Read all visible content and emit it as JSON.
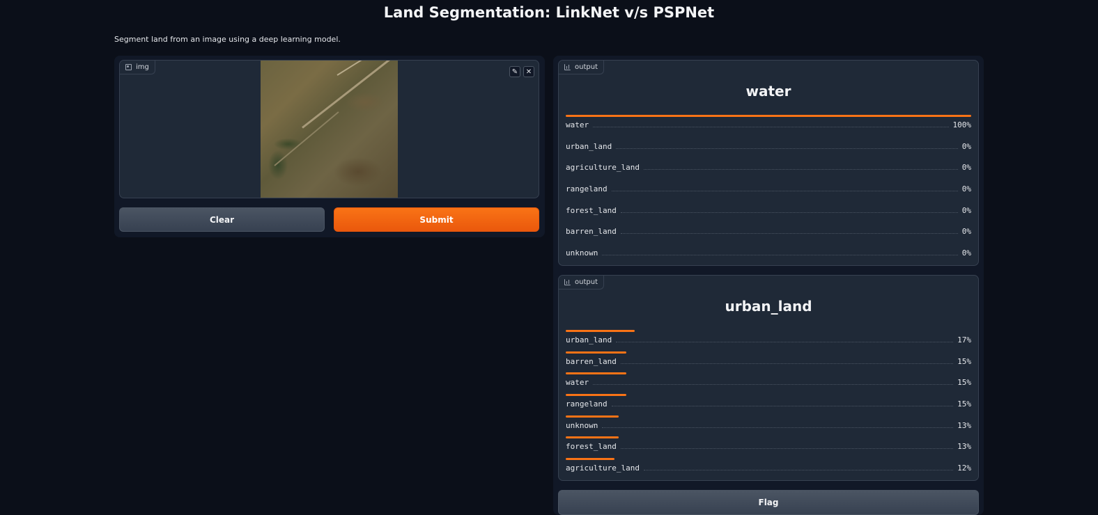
{
  "header": {
    "title": "Land Segmentation: LinkNet v/s PSPNet",
    "description": "Segment land from an image using a deep learning model."
  },
  "input": {
    "tag_label": "img",
    "image_alt": "satellite image",
    "edit_icon": "pencil-icon",
    "close_icon": "close-icon"
  },
  "buttons": {
    "clear": "Clear",
    "submit": "Submit",
    "flag": "Flag"
  },
  "outputs": [
    {
      "tag_label": "output",
      "top_label": "water",
      "rows": [
        {
          "label": "water",
          "value": "100%",
          "fraction": 1.0
        },
        {
          "label": "urban_land",
          "value": "0%",
          "fraction": 0.0
        },
        {
          "label": "agriculture_land",
          "value": "0%",
          "fraction": 0.0
        },
        {
          "label": "rangeland",
          "value": "0%",
          "fraction": 0.0
        },
        {
          "label": "forest_land",
          "value": "0%",
          "fraction": 0.0
        },
        {
          "label": "barren_land",
          "value": "0%",
          "fraction": 0.0
        },
        {
          "label": "unknown",
          "value": "0%",
          "fraction": 0.0
        }
      ]
    },
    {
      "tag_label": "output",
      "top_label": "urban_land",
      "rows": [
        {
          "label": "urban_land",
          "value": "17%",
          "fraction": 0.17
        },
        {
          "label": "barren_land",
          "value": "15%",
          "fraction": 0.15
        },
        {
          "label": "water",
          "value": "15%",
          "fraction": 0.15
        },
        {
          "label": "rangeland",
          "value": "15%",
          "fraction": 0.15
        },
        {
          "label": "unknown",
          "value": "13%",
          "fraction": 0.13
        },
        {
          "label": "forest_land",
          "value": "13%",
          "fraction": 0.13
        },
        {
          "label": "agriculture_land",
          "value": "12%",
          "fraction": 0.12
        }
      ]
    }
  ],
  "colors": {
    "accent": "#f97316",
    "background": "#0b0f19",
    "panel": "#1f2937"
  }
}
